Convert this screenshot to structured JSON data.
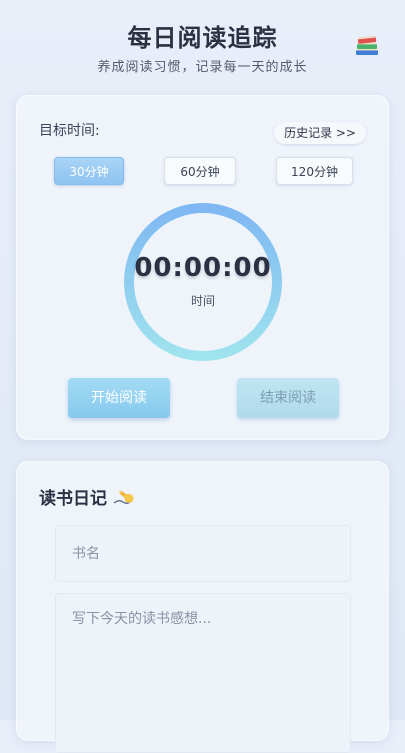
{
  "header": {
    "title": "每日阅读追踪",
    "subtitle": "养成阅读习惯，记录每一天的成长",
    "icon": "books-icon"
  },
  "timer_card": {
    "goal_label": "目标时间:",
    "history_label": "历史记录 >>",
    "goal_options": [
      {
        "label": "30分钟",
        "selected": true
      },
      {
        "label": "60分钟",
        "selected": false
      },
      {
        "label": "120分钟",
        "selected": false
      }
    ],
    "timer_value": "00:00:00",
    "timer_caption": "时间",
    "start_label": "开始阅读",
    "stop_label": "结束阅读"
  },
  "diary_card": {
    "title": "读书日记",
    "title_icon": "writing-hand-icon",
    "book_placeholder": "书名",
    "notes_placeholder": "写下今天的读书感想..."
  },
  "colors": {
    "accent": "#8fc3f1",
    "ring_start": "#7fb8f2",
    "ring_end": "#9fe3ee"
  }
}
